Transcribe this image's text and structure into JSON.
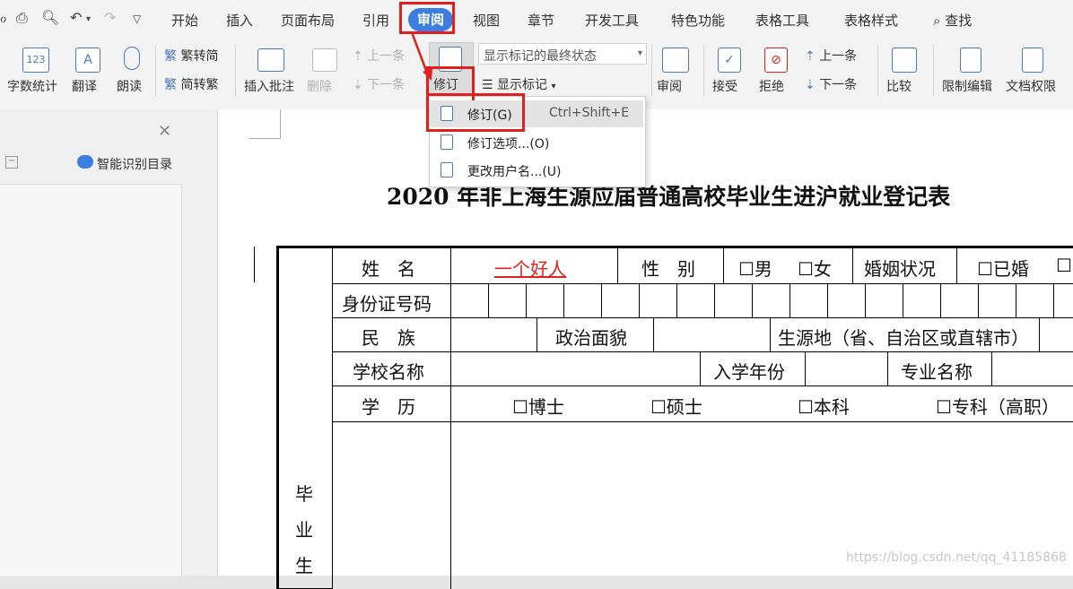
{
  "menubar": {
    "tabs": [
      "开始",
      "插入",
      "页面布局",
      "引用",
      "审阅",
      "视图",
      "章节",
      "开发工具",
      "特色功能",
      "表格工具",
      "表格样式"
    ],
    "active_tab": "审阅",
    "search_label": "查找"
  },
  "ribbon": {
    "word_count": "字数统计",
    "translate": "翻译",
    "read_aloud": "朗读",
    "trad_to_simp": "繁转简",
    "simp_to_trad": "简转繁",
    "insert_comment": "插入批注",
    "delete": "删除",
    "prev_comment": "上一条",
    "next_comment": "下一条",
    "track_changes": "修订",
    "markup_select": "显示标记的最终状态",
    "show_markup": "显示标记",
    "review": "审阅",
    "accept": "接受",
    "reject": "拒绝",
    "prev_change": "上一条",
    "next_change": "下一条",
    "compare": "比较",
    "restrict_edit": "限制编辑",
    "doc_rights": "文档权限"
  },
  "dropdown": {
    "items": [
      {
        "label": "修订(G)",
        "shortcut": "Ctrl+Shift+E"
      },
      {
        "label": "修订选项...(O)",
        "shortcut": ""
      },
      {
        "label": "更改用户名...(U)",
        "shortcut": ""
      }
    ]
  },
  "leftpane": {
    "smart_toc": "智能识别目录"
  },
  "document": {
    "title": "2020 年非上海生源应届普通高校毕业生进沪就业登记表",
    "row1": {
      "name_label": "姓　名",
      "name_value": "一个好人",
      "gender_label": "性　别",
      "male": "☐男",
      "female": "☐女",
      "marital_label": "婚姻状况",
      "married": "☐已婚",
      "more": "☐"
    },
    "row2": {
      "id_label": "身份证号码"
    },
    "row3": {
      "ethnic_label": "民　族",
      "political_label": "政治面貌",
      "origin_label": "生源地（省、自治区或直辖市）"
    },
    "row4": {
      "school_label": "学校名称",
      "enroll_label": "入学年份",
      "major_label": "专业名称"
    },
    "row5": {
      "edu_label": "学　历",
      "phd": "☐博士",
      "master": "☐硕士",
      "bachelor": "☐本科",
      "college": "☐专科（高职）"
    },
    "side_label": [
      "毕",
      "业",
      "生"
    ]
  },
  "watermark": "https://blog.csdn.net/qq_41185868",
  "colors": {
    "accent": "#3b7de0",
    "highlight": "#e0201c",
    "revision_text": "#e0201c"
  }
}
